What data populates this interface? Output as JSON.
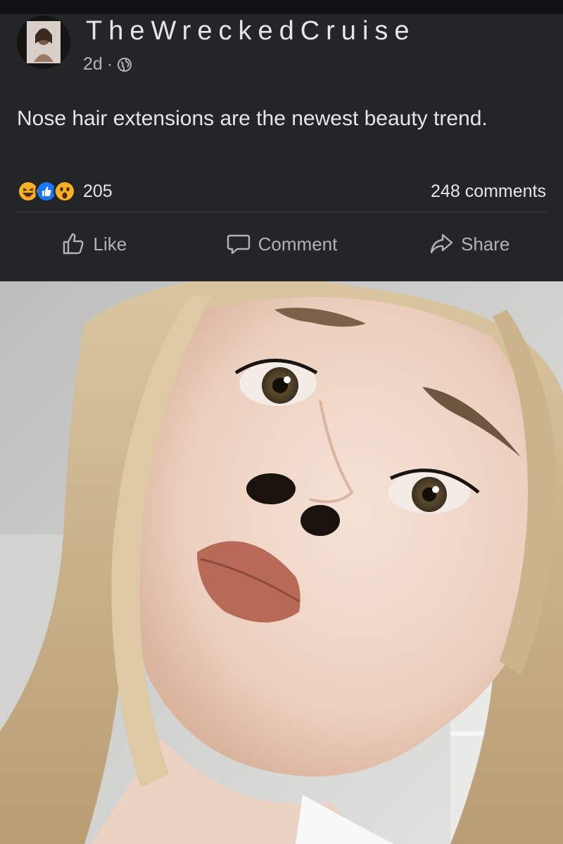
{
  "post": {
    "author": "TheWreckedCruise",
    "time": "2d",
    "separator": "·",
    "visibility_icon": "globe-icon",
    "text": "Nose hair extensions are the newest beauty trend.",
    "reactions": {
      "icons": [
        "haha-icon",
        "like-icon",
        "wow-icon"
      ],
      "count": "205"
    },
    "comments_count": "248 comments",
    "actions": {
      "like": "Like",
      "comment": "Comment",
      "share": "Share"
    },
    "photo": {
      "icon": "photo"
    }
  },
  "colors": {
    "background": "#242526",
    "text_primary": "#e4e6eb",
    "text_secondary": "#b0b3b8",
    "like_blue": "#1877f2",
    "emoji_yellow": "#f7b125"
  }
}
